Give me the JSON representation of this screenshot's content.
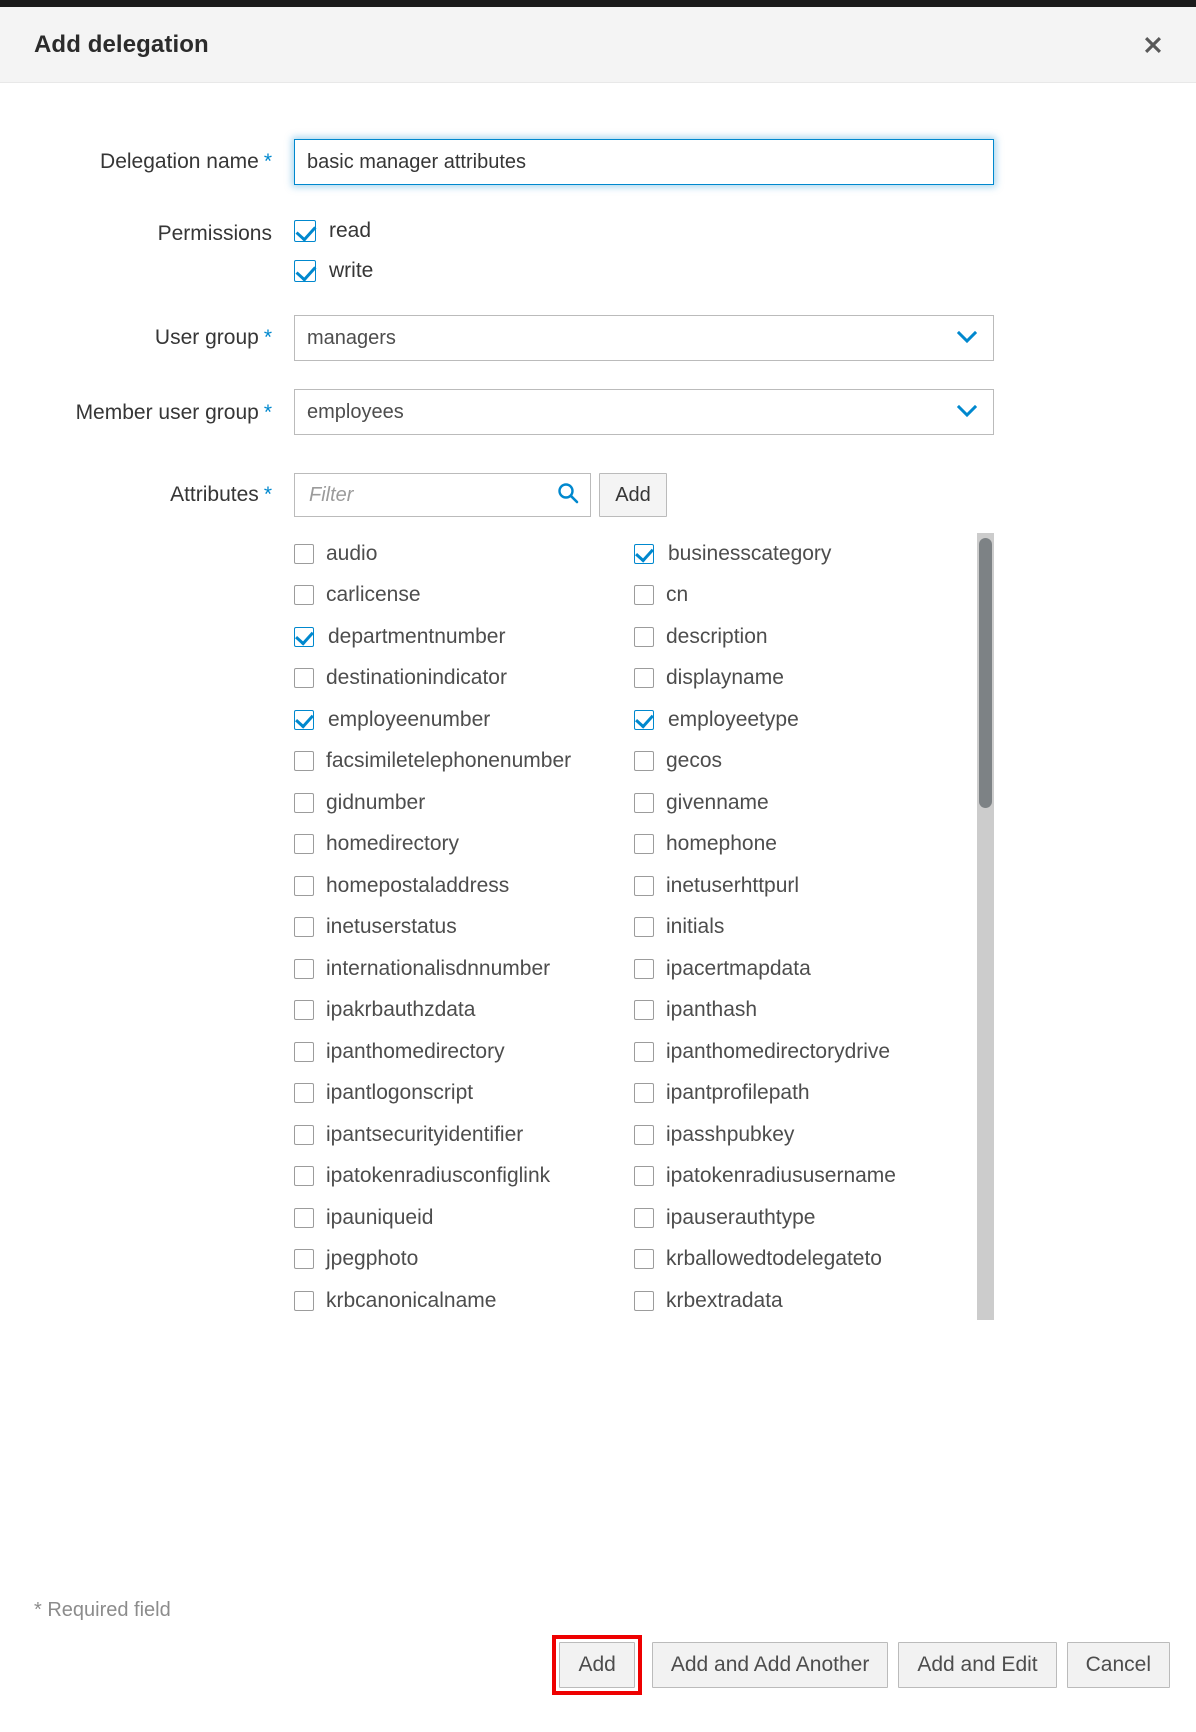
{
  "dialog": {
    "title": "Add delegation",
    "close_icon": "close-icon",
    "required_note": "* Required field"
  },
  "form": {
    "delegation_name": {
      "label": "Delegation name",
      "required_marker": "*",
      "value": "basic manager attributes"
    },
    "permissions": {
      "label": "Permissions",
      "options": [
        {
          "label": "read",
          "checked": true
        },
        {
          "label": "write",
          "checked": true
        }
      ]
    },
    "user_group": {
      "label": "User group",
      "required_marker": "*",
      "value": "managers"
    },
    "member_user_group": {
      "label": "Member user group",
      "required_marker": "*",
      "value": "employees"
    },
    "attributes": {
      "label": "Attributes",
      "required_marker": "*",
      "filter_placeholder": "Filter",
      "filter_value": "",
      "search_icon": "search-icon",
      "add_button_label": "Add",
      "left_column": [
        {
          "label": "audio",
          "checked": false
        },
        {
          "label": "carlicense",
          "checked": false
        },
        {
          "label": "departmentnumber",
          "checked": true
        },
        {
          "label": "destinationindicator",
          "checked": false
        },
        {
          "label": "employeenumber",
          "checked": true
        },
        {
          "label": "facsimiletelephonenumber",
          "checked": false
        },
        {
          "label": "gidnumber",
          "checked": false
        },
        {
          "label": "homedirectory",
          "checked": false
        },
        {
          "label": "homepostaladdress",
          "checked": false
        },
        {
          "label": "inetuserstatus",
          "checked": false
        },
        {
          "label": "internationalisdnnumber",
          "checked": false
        },
        {
          "label": "ipakrbauthzdata",
          "checked": false
        },
        {
          "label": "ipanthomedirectory",
          "checked": false
        },
        {
          "label": "ipantlogonscript",
          "checked": false
        },
        {
          "label": "ipantsecurityidentifier",
          "checked": false
        },
        {
          "label": "ipatokenradiusconfiglink",
          "checked": false
        },
        {
          "label": "ipauniqueid",
          "checked": false
        },
        {
          "label": "jpegphoto",
          "checked": false
        },
        {
          "label": "krbcanonicalname",
          "checked": false
        }
      ],
      "right_column": [
        {
          "label": "businesscategory",
          "checked": true
        },
        {
          "label": "cn",
          "checked": false
        },
        {
          "label": "description",
          "checked": false
        },
        {
          "label": "displayname",
          "checked": false
        },
        {
          "label": "employeetype",
          "checked": true
        },
        {
          "label": "gecos",
          "checked": false
        },
        {
          "label": "givenname",
          "checked": false
        },
        {
          "label": "homephone",
          "checked": false
        },
        {
          "label": "inetuserhttpurl",
          "checked": false
        },
        {
          "label": "initials",
          "checked": false
        },
        {
          "label": "ipacertmapdata",
          "checked": false
        },
        {
          "label": "ipanthash",
          "checked": false
        },
        {
          "label": "ipanthomedirectorydrive",
          "checked": false
        },
        {
          "label": "ipantprofilepath",
          "checked": false
        },
        {
          "label": "ipasshpubkey",
          "checked": false
        },
        {
          "label": "ipatokenradiususername",
          "checked": false
        },
        {
          "label": "ipauserauthtype",
          "checked": false
        },
        {
          "label": "krballowedtodelegateto",
          "checked": false
        },
        {
          "label": "krbextradata",
          "checked": false
        }
      ]
    }
  },
  "footer": {
    "buttons": [
      {
        "label": "Add",
        "highlighted": true
      },
      {
        "label": "Add and Add Another",
        "highlighted": false
      },
      {
        "label": "Add and Edit",
        "highlighted": false
      },
      {
        "label": "Cancel",
        "highlighted": false
      }
    ]
  },
  "colors": {
    "accent": "#0088ce",
    "header_bg": "#f4f4f4",
    "highlight": "#ee0000",
    "scrollbar_thumb": "#7d8285"
  }
}
